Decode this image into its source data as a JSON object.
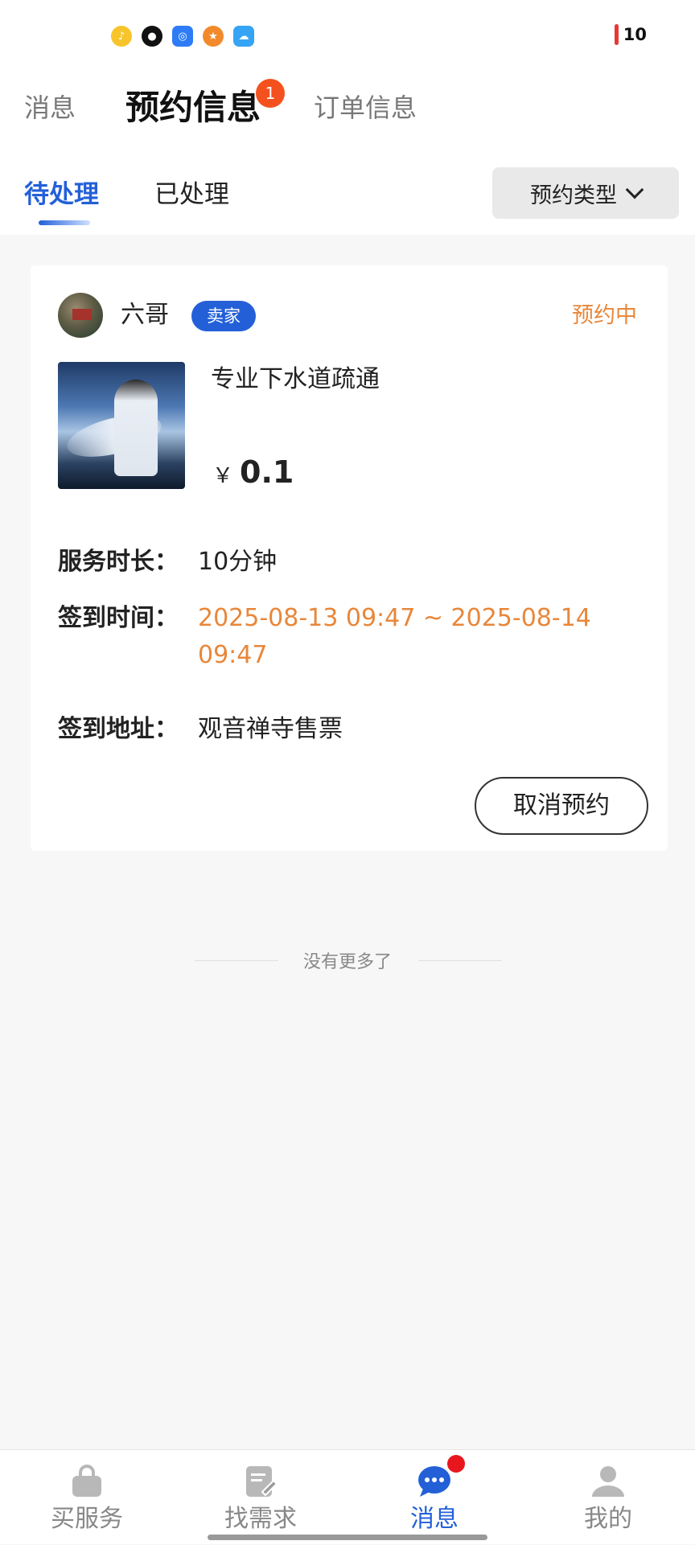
{
  "status_bar": {
    "battery_level": "10",
    "app_icons": [
      "music-app-icon",
      "qq-icon",
      "browser-icon",
      "game-app-icon",
      "cloud-app-icon"
    ]
  },
  "main_tabs": [
    {
      "label": "消息",
      "active": false
    },
    {
      "label": "预约信息",
      "active": true,
      "badge": "1"
    },
    {
      "label": "订单信息",
      "active": false
    }
  ],
  "sub_tabs": [
    {
      "label": "待处理",
      "active": true
    },
    {
      "label": "已处理",
      "active": false
    }
  ],
  "filter": {
    "label": "预约类型"
  },
  "appointment": {
    "seller_name": "六哥",
    "role": "卖家",
    "status": "预约中",
    "product_title": "专业下水道疏通",
    "currency": "￥",
    "price": "0.1",
    "duration_label": "服务时长：",
    "duration_value": "10分钟",
    "checkin_time_label": "签到时间：",
    "checkin_time_value": "2025-08-13 09:47 ~ 2025-08-14 09:47",
    "checkin_address_label": "签到地址：",
    "checkin_address_value": "观音禅寺售票",
    "cancel_label": "取消预约"
  },
  "list_end": "没有更多了",
  "bottom_nav": [
    {
      "label": "买服务",
      "icon": "shopping-bag-icon",
      "active": false
    },
    {
      "label": "找需求",
      "icon": "edit-note-icon",
      "active": false
    },
    {
      "label": "消息",
      "icon": "chat-bubble-icon",
      "active": true
    },
    {
      "label": "我的",
      "icon": "user-icon",
      "active": false
    }
  ],
  "colors": {
    "accent": "#2360d8",
    "status_orange": "#e8873a",
    "badge_red": "#f4511e"
  }
}
